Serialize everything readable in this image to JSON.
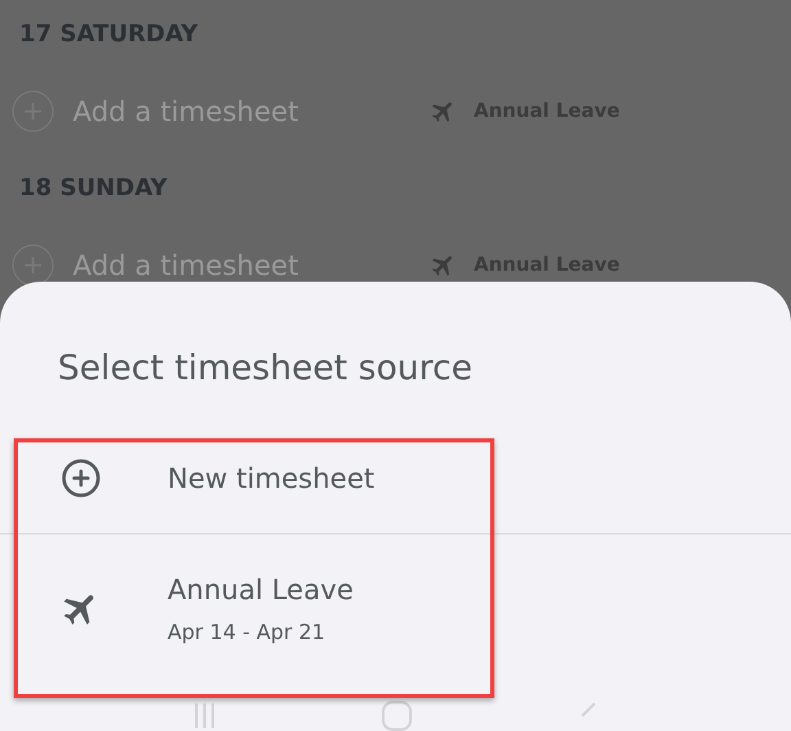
{
  "background_days": [
    {
      "day": "17 SATURDAY",
      "add_label": "Add a timesheet",
      "leave": "Annual Leave"
    },
    {
      "day": "18 SUNDAY",
      "add_label": "Add a timesheet",
      "leave": "Annual Leave"
    }
  ],
  "sheet": {
    "title": "Select timesheet source",
    "options": [
      {
        "kind": "new",
        "label": "New timesheet"
      },
      {
        "kind": "leave",
        "label": "Annual Leave",
        "dates": "Apr 14 - Apr 21"
      }
    ]
  }
}
